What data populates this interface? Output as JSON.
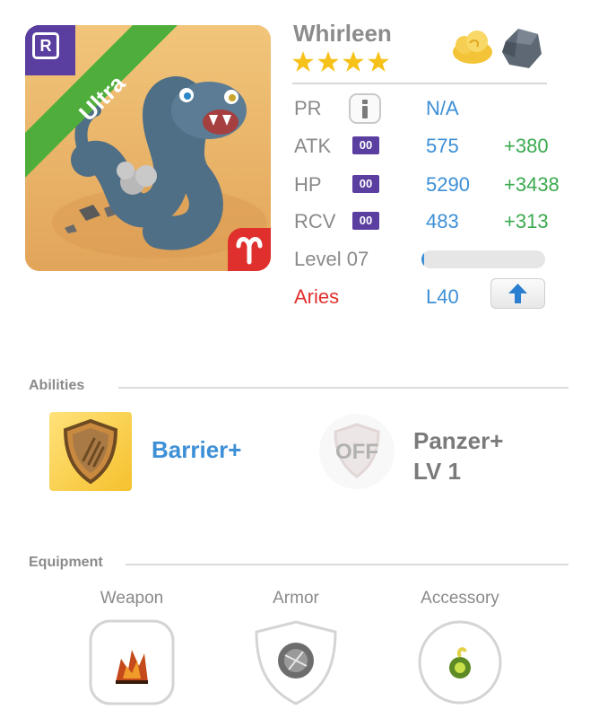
{
  "monster": {
    "name": "Whirleen",
    "rarity_letter": "R",
    "tier": "Ultra",
    "stars": 4
  },
  "stats": {
    "pr": {
      "label": "PR",
      "value": "N/A"
    },
    "atk": {
      "label": "ATK",
      "badge": "00",
      "value": "575",
      "bonus": "+380"
    },
    "hp": {
      "label": "HP",
      "badge": "00",
      "value": "5290",
      "bonus": "+3438"
    },
    "rcv": {
      "label": "RCV",
      "badge": "00",
      "value": "483",
      "bonus": "+313"
    }
  },
  "level": {
    "label": "Level 07",
    "progress": 0.02
  },
  "zodiac": {
    "label": "Aries",
    "limit": "L40"
  },
  "abilities": {
    "title": "Abilities",
    "items": [
      {
        "name": "Barrier+"
      },
      {
        "name_line1": "Panzer+",
        "name_line2": "LV 1",
        "state": "OFF"
      }
    ]
  },
  "equipment": {
    "title": "Equipment",
    "slots": [
      {
        "label": "Weapon"
      },
      {
        "label": "Armor"
      },
      {
        "label": "Accessory"
      }
    ]
  },
  "icons": {
    "info": "info-icon",
    "upgrade": "arrow-up-icon",
    "cloud": "cloud-evolution-icon",
    "stone": "stone-element-icon",
    "zodiac": "aries-icon",
    "shield": "shield-claw-icon"
  },
  "colors": {
    "accent_blue": "#3d8fd6",
    "bonus_green": "#3aaa4f",
    "zodiac_red": "#e0302d",
    "badge_purple": "#5a3fa0",
    "ribbon_green": "#4fae3b"
  }
}
